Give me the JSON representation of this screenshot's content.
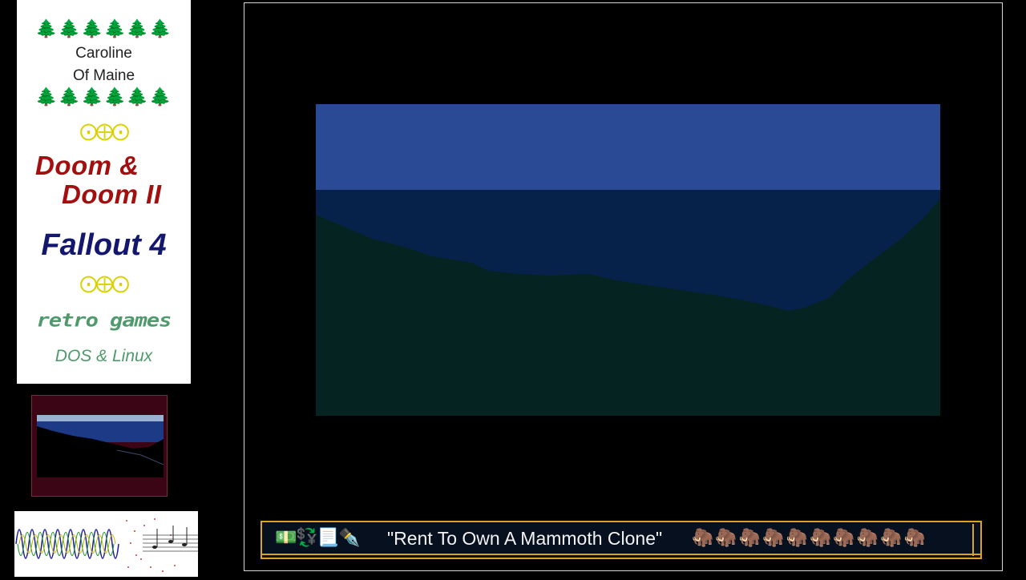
{
  "branding": {
    "trees": "🌲🌲🌲🌲🌲🌲",
    "streamer_name": "Caroline\nOf Maine",
    "ornament": "⨀⨁⨀",
    "games": {
      "doom_line_1": "Doom &",
      "doom_line_2": "Doom II",
      "fallout": "Fallout 4"
    },
    "retro_label": "retro games",
    "platforms": "DOS & Linux"
  },
  "ticker": {
    "icons": "💵💱📃✒️",
    "title": "\"Rent To Own A Mammoth Clone\"",
    "mammoths": "🦣🦣🦣🦣🦣🦣🦣🦣🦣🦣"
  },
  "colors": {
    "sky": "#2a4a95",
    "far_hills": "#06224a",
    "ground": "#052320",
    "doom_red": "#a30f0f",
    "fallout_blue": "#13186e",
    "retro_green": "#4f9a6c",
    "ticker_border": "#d9a520"
  },
  "icons": [
    "tree-icon",
    "ornament-icon",
    "money-icon",
    "exchange-icon",
    "document-icon",
    "pen-icon",
    "mammoth-icon"
  ]
}
